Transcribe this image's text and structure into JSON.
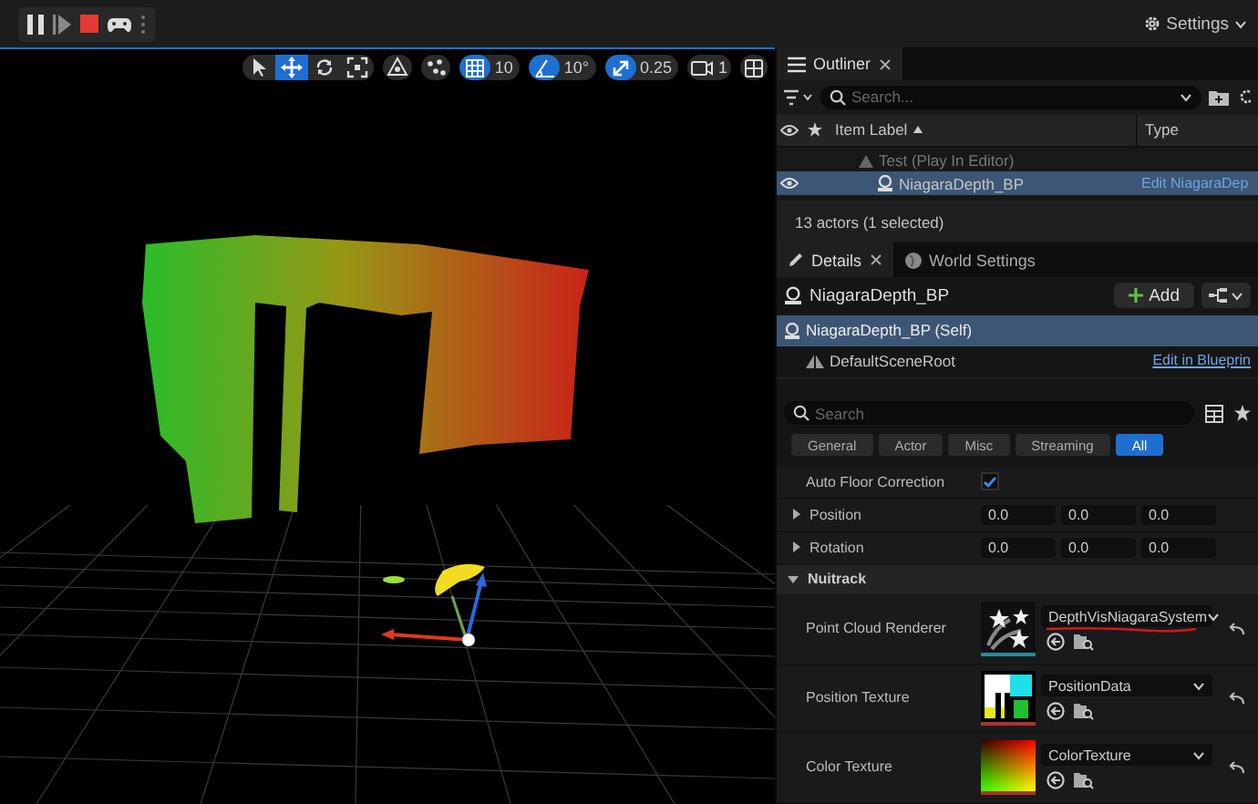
{
  "toolbar": {
    "settings": "Settings"
  },
  "viewport": {
    "tools": [
      {
        "kind": "select",
        "selected": false
      },
      {
        "kind": "translate",
        "selected": true
      },
      {
        "kind": "rotate",
        "selected": false
      },
      {
        "kind": "scale",
        "selected": false
      }
    ],
    "snaps": [
      {
        "kind": "grid",
        "value": "10",
        "on": true
      },
      {
        "kind": "angle",
        "value": "10°",
        "on": true
      },
      {
        "kind": "scale",
        "value": "0.25",
        "on": true
      }
    ],
    "camera_speed": "1"
  },
  "outliner": {
    "title": "Outliner",
    "search": {
      "placeholder": "Search..."
    },
    "columns": [
      "Item Label",
      "Type"
    ],
    "rows": [
      {
        "kind": "world",
        "label": "Test (Play In Editor)",
        "selected": false,
        "visible": false
      },
      {
        "kind": "actor",
        "label": "NiagaraDepth_BP",
        "type": "Edit NiagaraDep",
        "selected": true,
        "visible": true
      }
    ],
    "status": "13 actors (1 selected)"
  },
  "details": {
    "tabs": [
      {
        "label": "Details",
        "selected": true
      },
      {
        "label": "World Settings",
        "selected": false
      }
    ],
    "actor": "NiagaraDepth_BP",
    "add_button": "Add",
    "components": [
      {
        "label": "NiagaraDepth_BP (Self)",
        "selected": true,
        "children": [
          {
            "label": "DefaultSceneRoot",
            "link": "Edit in Blueprin",
            "selected": false
          }
        ]
      }
    ],
    "search": {
      "placeholder": "Search"
    },
    "filters": [
      {
        "label": "General",
        "selected": false
      },
      {
        "label": "Actor",
        "selected": false
      },
      {
        "label": "Misc",
        "selected": false
      },
      {
        "label": "Streaming",
        "selected": false
      },
      {
        "label": "All",
        "selected": true
      }
    ],
    "properties": [
      {
        "kind": "checkbox",
        "label": "Auto Floor Correction",
        "checked": true
      },
      {
        "kind": "vector",
        "label": "Position",
        "expanded": false,
        "values": [
          "0.0",
          "0.0",
          "0.0"
        ]
      },
      {
        "kind": "vector",
        "label": "Rotation",
        "expanded": false,
        "values": [
          "0.0",
          "0.0",
          "0.0"
        ]
      },
      {
        "kind": "category",
        "label": "Nuitrack",
        "expanded": true
      },
      {
        "kind": "asset",
        "label": "Point Cloud Renderer",
        "asset": "DepthVisNiagaraSystem",
        "thumbnail": {
          "kind": "particles"
        },
        "annotated": true
      },
      {
        "kind": "asset",
        "label": "Position Texture",
        "asset": "PositionData",
        "thumbnail": {
          "kind": "position"
        },
        "annotated": false
      },
      {
        "kind": "asset",
        "label": "Color Texture",
        "asset": "ColorTexture",
        "thumbnail": {
          "kind": "gradient"
        },
        "annotated": false
      }
    ]
  }
}
